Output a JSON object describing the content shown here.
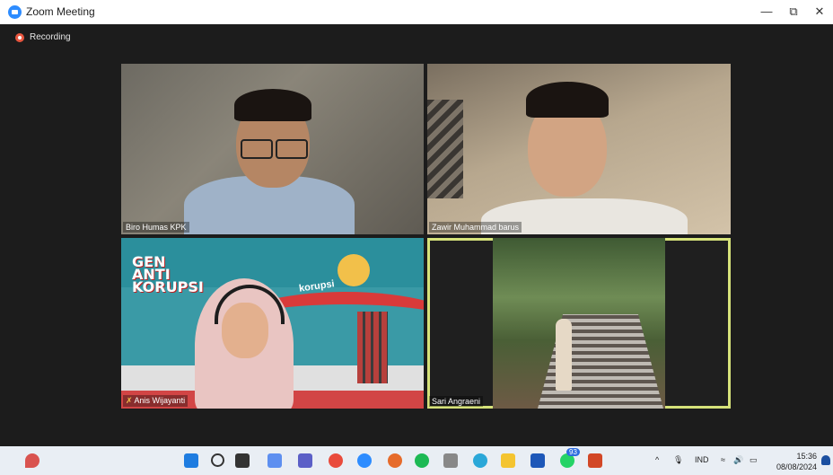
{
  "window": {
    "title": "Zoom Meeting",
    "minimize": "—",
    "restore": "⧉",
    "close": "✕"
  },
  "recording": {
    "label": "Recording"
  },
  "participants": [
    {
      "name": "Biro Humas KPK"
    },
    {
      "name": "Zawir Muhammad barus"
    },
    {
      "name": "Anis Wijayanti"
    },
    {
      "name": "Sari Angraeni"
    }
  ],
  "banner": {
    "logo": "GEN ANTI KORUPSI",
    "slogan": "korupsi"
  },
  "taskbar": {
    "tray": {
      "caret": "^",
      "mic": "🎙",
      "lang": "IND",
      "wifi": "≈",
      "volume": "🔊",
      "battery": "▭"
    },
    "clock": {
      "time": "15:36",
      "date": "08/08/2024"
    },
    "badge": "93"
  },
  "colors": {
    "accent": "#2d8cff",
    "active_speaker": "#d6e27a",
    "recording": "#e8563f"
  }
}
